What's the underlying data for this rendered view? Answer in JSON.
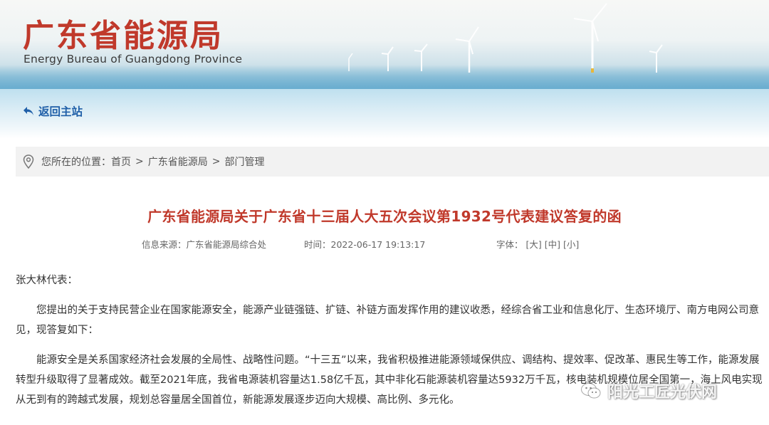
{
  "header": {
    "site_title": "广东省能源局",
    "site_subtitle": "Energy Bureau of Guangdong Province"
  },
  "nav": {
    "home_label": "返回主站"
  },
  "breadcrumb": {
    "prefix": "您所在的位置：",
    "items": [
      "首页",
      "广东省能源局",
      "部门管理"
    ],
    "separator": ">"
  },
  "article": {
    "title": "广东省能源局关于广东省十三届人大五次会议第1932号代表建议答复的函",
    "meta": {
      "source_label": "信息来源：",
      "source_value": "广东省能源局综合处",
      "time_label": "时间：",
      "time_value": "2022-06-17 19:13:17",
      "font_label": "字体：",
      "sizes": [
        "[大]",
        "[中]",
        "[小]"
      ]
    },
    "paragraphs": [
      "张大林代表：",
      "您提出的关于支持民营企业在国家能源安全，能源产业链强链、扩链、补链方面发挥作用的建议收悉，经综合省工业和信息化厅、生态环境厅、南方电网公司意见，现答复如下：",
      "能源安全是关系国家经济社会发展的全局性、战略性问题。“十三五”以来，我省积极推进能源领域保供应、调结构、提效率、促改革、惠民生等工作，能源发展转型升级取得了显著成效。截至2021年底，我省电源装机容量达1.58亿千瓦，其中非化石能源装机容量达5932万千瓦，核电装机规模位居全国第一，海上风电实现从无到有的跨越式发展，规划总容量居全国首位，新能源发展逐步迈向大规模、高比例、多元化。"
    ]
  },
  "watermark": {
    "text": "阳光工匠光伏网",
    "icon": "wechat-icon"
  },
  "colors": {
    "brand_red": "#c0392b",
    "link_blue": "#1f5fa8",
    "breadcrumb_bg": "#f2f2f2"
  }
}
